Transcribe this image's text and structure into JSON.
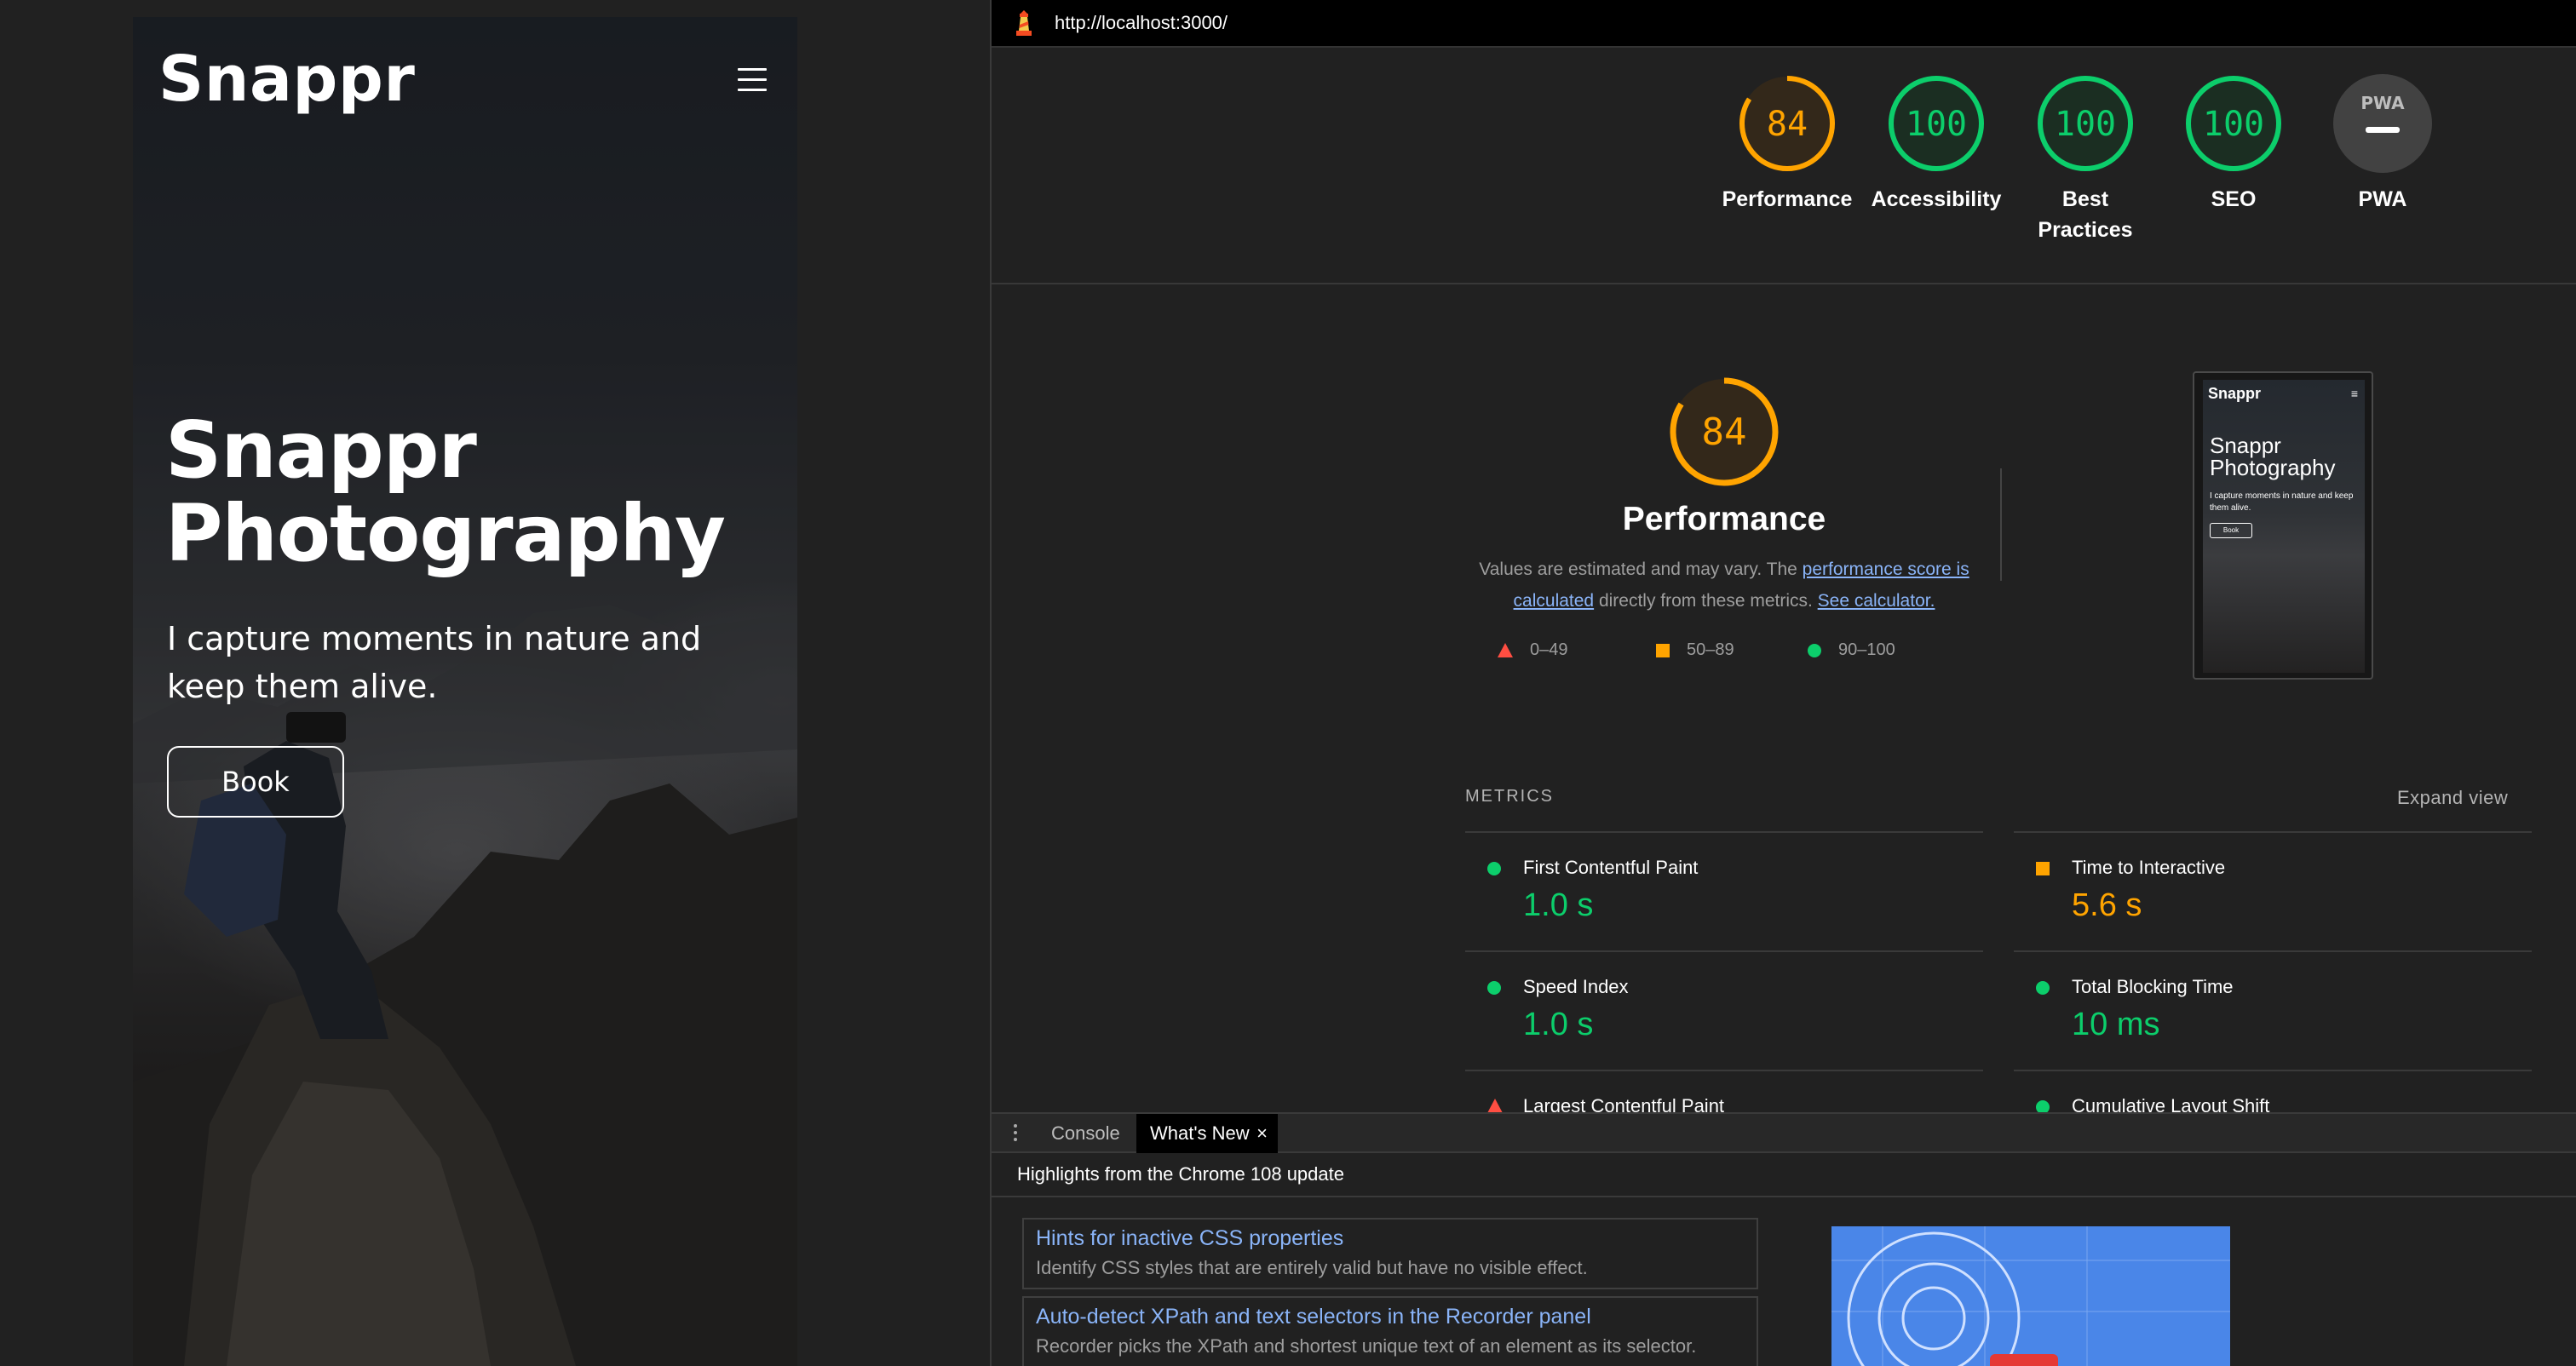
{
  "phone": {
    "brand": "Snappr",
    "hero_title_line1": "Snappr",
    "hero_title_line2": "Photography",
    "hero_subtitle": "I capture moments in nature and keep them alive.",
    "book_label": "Book"
  },
  "devtools": {
    "url": "http://localhost:3000/",
    "gauges": [
      {
        "score": "84",
        "label": "Performance",
        "color": "#ffa400"
      },
      {
        "score": "100",
        "label": "Accessibility",
        "color": "#0cce6b"
      },
      {
        "score": "100",
        "label_line1": "Best",
        "label_line2": "Practices",
        "color": "#0cce6b"
      },
      {
        "score": "100",
        "label": "SEO",
        "color": "#0cce6b"
      },
      {
        "score": "PWA",
        "label": "PWA",
        "color": "#555555"
      }
    ],
    "performance": {
      "score": "84",
      "title": "Performance",
      "desc_prefix": "Values are estimated and may vary. The ",
      "desc_link1": "performance score is calculated",
      "desc_mid": " directly from these metrics. ",
      "desc_link2": "See calculator.",
      "legend": [
        "0–49",
        "50–89",
        "90–100"
      ]
    },
    "thumbnail": {
      "brand": "Snappr",
      "menu_glyph": "≡",
      "title_line1": "Snappr",
      "title_line2": "Photography",
      "subtitle": "I capture moments in nature and keep them alive.",
      "book": "Book"
    },
    "metrics": {
      "heading": "METRICS",
      "expand": "Expand view",
      "items": [
        {
          "name": "First Contentful Paint",
          "value": "1.0 s",
          "status": "pass",
          "color": "#0cce6b"
        },
        {
          "name": "Time to Interactive",
          "value": "5.6 s",
          "status": "average",
          "color": "#ffa400"
        },
        {
          "name": "Speed Index",
          "value": "1.0 s",
          "status": "pass",
          "color": "#0cce6b"
        },
        {
          "name": "Total Blocking Time",
          "value": "10 ms",
          "status": "pass",
          "color": "#0cce6b"
        },
        {
          "name": "Largest Contentful Paint",
          "value": "",
          "status": "fail",
          "color": "#ff4e42"
        },
        {
          "name": "Cumulative Layout Shift",
          "value": "",
          "status": "pass",
          "color": "#0cce6b"
        }
      ]
    },
    "drawer": {
      "tabs": [
        "Console",
        "What's New"
      ],
      "close_glyph": "×",
      "highlights_heading": "Highlights from the Chrome 108 update",
      "cards": [
        {
          "title": "Hints for inactive CSS properties",
          "desc": "Identify CSS styles that are entirely valid but have no visible effect."
        },
        {
          "title": "Auto-detect XPath and text selectors in the Recorder panel",
          "desc": "Recorder picks the XPath and shortest unique text of an element as its selector."
        }
      ]
    }
  }
}
